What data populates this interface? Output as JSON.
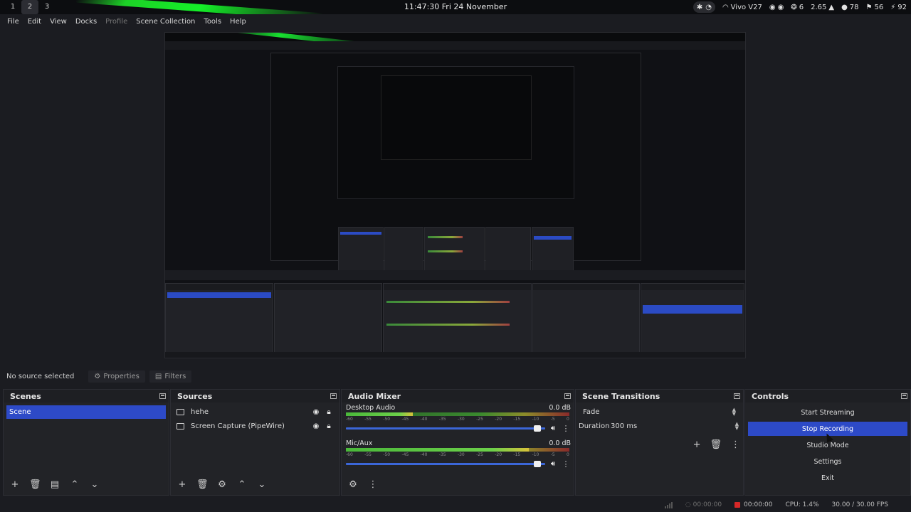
{
  "system_bar": {
    "workspaces": [
      "1",
      "2",
      "3"
    ],
    "active_workspace": "2",
    "clock": "11:47:30 Fri 24 November",
    "wifi_name": "Vivo V27",
    "cpu_count": "6",
    "load": "2.65",
    "stat_a": "78",
    "stat_b": "56",
    "battery": "92"
  },
  "menu": {
    "file": "File",
    "edit": "Edit",
    "view": "View",
    "docks": "Docks",
    "profile": "Profile",
    "scene_collection": "Scene Collection",
    "tools": "Tools",
    "help": "Help"
  },
  "source_bar": {
    "no_source": "No source selected",
    "properties": "Properties",
    "filters": "Filters"
  },
  "scenes": {
    "title": "Scenes",
    "items": [
      "Scene"
    ]
  },
  "sources": {
    "title": "Sources",
    "items": [
      {
        "name": "hehe"
      },
      {
        "name": "Screen Capture (PipeWire)"
      }
    ]
  },
  "audio_mixer": {
    "title": "Audio Mixer",
    "ticks": [
      "-60",
      "-55",
      "-50",
      "-45",
      "-40",
      "-35",
      "-30",
      "-25",
      "-20",
      "-15",
      "-10",
      "-5",
      "0"
    ],
    "channels": [
      {
        "name": "Desktop Audio",
        "level": "0.0 dB",
        "meter_fill": 0.3,
        "volume": 1.0
      },
      {
        "name": "Mic/Aux",
        "level": "0.0 dB",
        "meter_fill": 0.82,
        "volume": 1.0
      }
    ]
  },
  "scene_transitions": {
    "title": "Scene Transitions",
    "transition": "Fade",
    "duration_label": "Duration",
    "duration_value": "300 ms"
  },
  "controls": {
    "title": "Controls",
    "start_streaming": "Start Streaming",
    "stop_recording": "Stop Recording",
    "studio_mode": "Studio Mode",
    "settings": "Settings",
    "exit": "Exit"
  },
  "status_bar": {
    "stream_time": "00:00:00",
    "rec_time": "00:00:00",
    "cpu": "CPU: 1.4%",
    "fps": "30.00 / 30.00 FPS"
  },
  "colors": {
    "accent": "#2d4ac7",
    "background": "#1b1c21",
    "dock": "#222327",
    "recording": "#d62828"
  }
}
